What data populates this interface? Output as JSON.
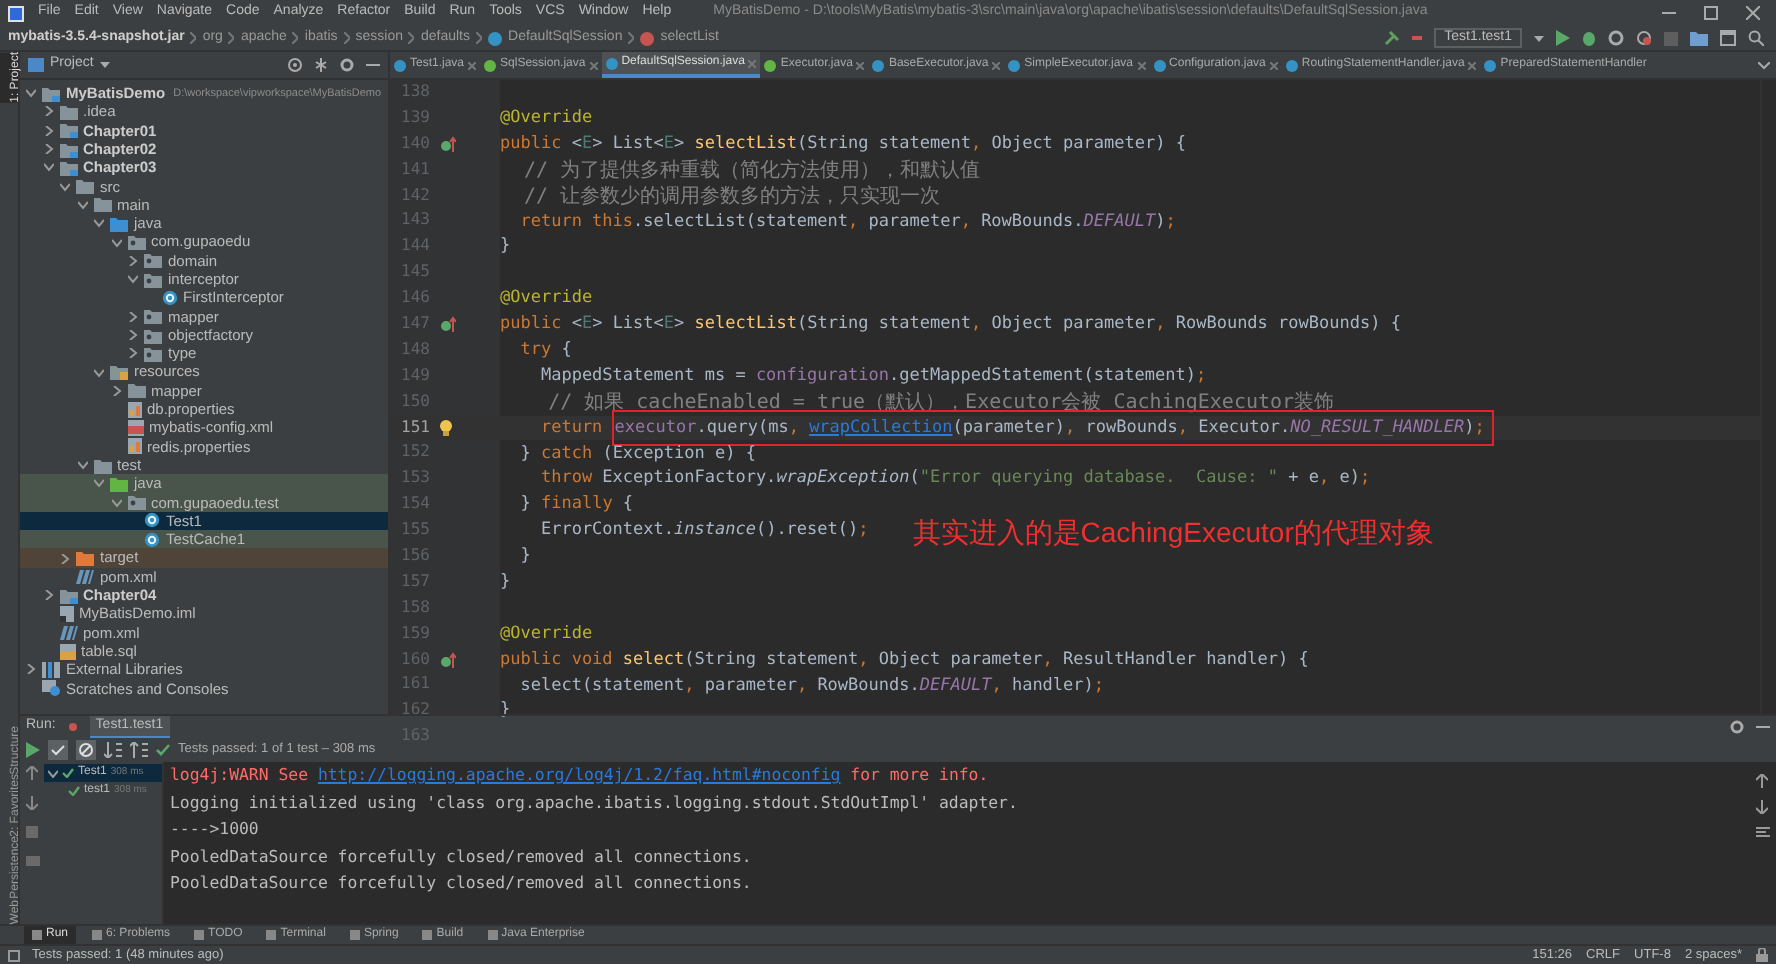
{
  "window": {
    "title": "MyBatisDemo - D:\\tools\\MyBatis\\mybatis-3\\src\\main\\java\\org\\apache\\ibatis\\session\\defaults\\DefaultSqlSession.java"
  },
  "menu": [
    "File",
    "Edit",
    "View",
    "Navigate",
    "Code",
    "Analyze",
    "Refactor",
    "Build",
    "Run",
    "Tools",
    "VCS",
    "Window",
    "Help"
  ],
  "breadcrumbs": [
    {
      "label": "mybatis-3.5.4-snapshot.jar",
      "kind": "jar"
    },
    {
      "label": "org",
      "kind": "package"
    },
    {
      "label": "apache",
      "kind": "package"
    },
    {
      "label": "ibatis",
      "kind": "package"
    },
    {
      "label": "session",
      "kind": "package"
    },
    {
      "label": "defaults",
      "kind": "package"
    },
    {
      "label": "DefaultSqlSession",
      "kind": "class"
    },
    {
      "label": "selectList",
      "kind": "method"
    }
  ],
  "run_config": "Test1.test1",
  "project_panel": {
    "title": "Project"
  },
  "left_strip": [
    {
      "label": "1: Project",
      "selected": true
    },
    {
      "label": "Structure",
      "selected": false
    },
    {
      "label": "2: Favorites",
      "selected": false
    },
    {
      "label": "Persistence",
      "selected": false
    },
    {
      "label": "Web",
      "selected": false
    }
  ],
  "tree": [
    {
      "label": "MyBatisDemo",
      "path": "D:\\workspace\\vipworkspace\\MyBatisDemo",
      "kind": "module",
      "expanded": true,
      "selected": false,
      "children": [
        {
          "label": ".idea",
          "kind": "folder",
          "expanded": false,
          "selected": false
        },
        {
          "label": "Chapter01",
          "kind": "module",
          "expanded": false,
          "selected": false
        },
        {
          "label": "Chapter02",
          "kind": "module",
          "expanded": false,
          "selected": false
        },
        {
          "label": "Chapter03",
          "kind": "module",
          "expanded": true,
          "selected": false,
          "children": [
            {
              "label": "src",
              "kind": "folder",
              "expanded": true,
              "selected": false,
              "children": [
                {
                  "label": "main",
                  "kind": "folder",
                  "expanded": true,
                  "selected": false,
                  "children": [
                    {
                      "label": "java",
                      "kind": "source-folder",
                      "expanded": true,
                      "selected": false,
                      "children": [
                        {
                          "label": "com.gupaoedu",
                          "kind": "package",
                          "expanded": true,
                          "selected": false,
                          "children": [
                            {
                              "label": "domain",
                              "kind": "package",
                              "expanded": false,
                              "selected": false
                            },
                            {
                              "label": "interceptor",
                              "kind": "package",
                              "expanded": true,
                              "selected": false,
                              "children": [
                                {
                                  "label": "FirstInterceptor",
                                  "kind": "class",
                                  "selected": false
                                }
                              ]
                            },
                            {
                              "label": "mapper",
                              "kind": "package",
                              "expanded": false,
                              "selected": false
                            },
                            {
                              "label": "objectfactory",
                              "kind": "package",
                              "expanded": false,
                              "selected": false
                            },
                            {
                              "label": "type",
                              "kind": "package",
                              "expanded": false,
                              "selected": false
                            }
                          ]
                        }
                      ]
                    },
                    {
                      "label": "resources",
                      "kind": "resources-folder",
                      "expanded": true,
                      "selected": false,
                      "children": [
                        {
                          "label": "mapper",
                          "kind": "folder",
                          "expanded": false,
                          "selected": false
                        },
                        {
                          "label": "db.properties",
                          "kind": "properties",
                          "selected": false
                        },
                        {
                          "label": "mybatis-config.xml",
                          "kind": "xml",
                          "selected": false
                        },
                        {
                          "label": "redis.properties",
                          "kind": "properties",
                          "selected": false
                        }
                      ]
                    }
                  ]
                },
                {
                  "label": "test",
                  "kind": "folder",
                  "expanded": true,
                  "selected": false,
                  "children": [
                    {
                      "label": "java",
                      "kind": "test-folder",
                      "expanded": true,
                      "selected": false,
                      "children": [
                        {
                          "label": "com.gupaoedu.test",
                          "kind": "test-package",
                          "expanded": true,
                          "selected": false,
                          "children": [
                            {
                              "label": "Test1",
                              "kind": "test-class",
                              "selected": true
                            },
                            {
                              "label": "TestCache1",
                              "kind": "test-class",
                              "selected": false
                            }
                          ]
                        }
                      ]
                    }
                  ]
                }
              ]
            },
            {
              "label": "target",
              "kind": "excluded-folder",
              "expanded": false,
              "selected": false
            },
            {
              "label": "pom.xml",
              "kind": "maven",
              "selected": false
            }
          ]
        },
        {
          "label": "Chapter04",
          "kind": "module",
          "expanded": false,
          "selected": false
        },
        {
          "label": "MyBatisDemo.iml",
          "kind": "iml",
          "selected": false
        },
        {
          "label": "pom.xml",
          "kind": "maven",
          "selected": false
        },
        {
          "label": "table.sql",
          "kind": "sql",
          "selected": false
        }
      ]
    },
    {
      "label": "External Libraries",
      "kind": "libraries",
      "expanded": false,
      "selected": false
    },
    {
      "label": "Scratches and Consoles",
      "kind": "scratches",
      "selected": false
    }
  ],
  "editor_tabs": [
    {
      "label": "Test1.java",
      "kind": "class",
      "selected": false
    },
    {
      "label": "SqlSession.java",
      "kind": "interface",
      "selected": false
    },
    {
      "label": "DefaultSqlSession.java",
      "kind": "class",
      "selected": true
    },
    {
      "label": "Executor.java",
      "kind": "interface",
      "selected": false
    },
    {
      "label": "BaseExecutor.java",
      "kind": "class",
      "selected": false
    },
    {
      "label": "SimpleExecutor.java",
      "kind": "class",
      "selected": false
    },
    {
      "label": "Configuration.java",
      "kind": "class",
      "selected": false
    },
    {
      "label": "RoutingStatementHandler.java",
      "kind": "class",
      "selected": false
    },
    {
      "label": "PreparedStatementHandler",
      "kind": "class",
      "selected": false
    }
  ],
  "code_lines": [
    {
      "number": "138",
      "kind": "code",
      "current": false
    },
    {
      "number": "139",
      "kind": "code",
      "current": false,
      "tokens": [
        {
          "text": "@Override",
          "kind": "annotation"
        }
      ]
    },
    {
      "number": "140",
      "kind": "override",
      "current": false,
      "tokens": [
        {
          "text": "public ",
          "kind": "keyword"
        },
        {
          "text": "<",
          "kind": "plain"
        },
        {
          "text": "E",
          "kind": "type-param"
        },
        {
          "text": "> List<",
          "kind": "plain"
        },
        {
          "text": "E",
          "kind": "type-param"
        },
        {
          "text": "> ",
          "kind": "plain"
        },
        {
          "text": "selectList",
          "kind": "method"
        },
        {
          "text": "(String statement",
          "kind": "plain"
        },
        {
          "text": ", ",
          "kind": "keyword"
        },
        {
          "text": "Object parameter) {",
          "kind": "plain"
        }
      ]
    },
    {
      "number": "141",
      "kind": "code",
      "current": false,
      "tokens": [
        {
          "text": "  // 为了提供多种重载（简化方法使用），和默认值",
          "kind": "comment"
        }
      ]
    },
    {
      "number": "142",
      "kind": "code",
      "current": false,
      "tokens": [
        {
          "text": "  // 让参数少的调用参数多的方法，只实现一次",
          "kind": "comment"
        }
      ]
    },
    {
      "number": "143",
      "kind": "code",
      "current": false,
      "tokens": [
        {
          "text": "  return this",
          "kind": "keyword"
        },
        {
          "text": ".selectList(statement",
          "kind": "plain"
        },
        {
          "text": ", ",
          "kind": "keyword"
        },
        {
          "text": "parameter",
          "kind": "plain"
        },
        {
          "text": ", ",
          "kind": "keyword"
        },
        {
          "text": "RowBounds.",
          "kind": "plain"
        },
        {
          "text": "DEFAULT",
          "kind": "constant"
        },
        {
          "text": ")",
          "kind": "plain"
        },
        {
          "text": ";",
          "kind": "keyword"
        }
      ]
    },
    {
      "number": "144",
      "kind": "code",
      "current": false,
      "tokens": [
        {
          "text": "}",
          "kind": "plain"
        }
      ]
    },
    {
      "number": "145",
      "kind": "code",
      "current": false
    },
    {
      "number": "146",
      "kind": "code",
      "current": false,
      "tokens": [
        {
          "text": "@Override",
          "kind": "annotation"
        }
      ]
    },
    {
      "number": "147",
      "kind": "override",
      "current": false,
      "tokens": [
        {
          "text": "public ",
          "kind": "keyword"
        },
        {
          "text": "<",
          "kind": "plain"
        },
        {
          "text": "E",
          "kind": "type-param"
        },
        {
          "text": "> List<",
          "kind": "plain"
        },
        {
          "text": "E",
          "kind": "type-param"
        },
        {
          "text": "> ",
          "kind": "plain"
        },
        {
          "text": "selectList",
          "kind": "method"
        },
        {
          "text": "(String statement",
          "kind": "plain"
        },
        {
          "text": ", ",
          "kind": "keyword"
        },
        {
          "text": "Object parameter",
          "kind": "plain"
        },
        {
          "text": ", ",
          "kind": "keyword"
        },
        {
          "text": "RowBounds rowBounds) {",
          "kind": "plain"
        }
      ]
    },
    {
      "number": "148",
      "kind": "code",
      "current": false,
      "tokens": [
        {
          "text": "  try",
          "kind": "keyword"
        },
        {
          "text": " {",
          "kind": "plain"
        }
      ]
    },
    {
      "number": "149",
      "kind": "code",
      "current": false,
      "tokens": [
        {
          "text": "    MappedStatement ms = ",
          "kind": "plain"
        },
        {
          "text": "configuration",
          "kind": "field"
        },
        {
          "text": ".getMappedStatement(statement)",
          "kind": "plain"
        },
        {
          "text": ";",
          "kind": "keyword"
        }
      ]
    },
    {
      "number": "150",
      "kind": "code",
      "current": false,
      "tokens": [
        {
          "text": "    // 如果 cacheEnabled = true（默认），Executor会被 CachingExecutor装饰",
          "kind": "comment"
        }
      ]
    },
    {
      "number": "151",
      "kind": "intention",
      "current": true,
      "tokens": [
        {
          "text": "    return ",
          "kind": "keyword"
        }
      ],
      "boxed_tokens": [
        {
          "text": "executor",
          "kind": "field"
        },
        {
          "text": ".query(ms",
          "kind": "plain"
        },
        {
          "text": ", ",
          "kind": "keyword"
        },
        {
          "text": "wrapCollection",
          "kind": "link"
        },
        {
          "text": "(parameter)",
          "kind": "plain"
        },
        {
          "text": ", ",
          "kind": "keyword"
        },
        {
          "text": "rowBounds",
          "kind": "plain"
        },
        {
          "text": ", ",
          "kind": "keyword"
        },
        {
          "text": "Executor.",
          "kind": "plain"
        },
        {
          "text": "NO_RESULT_HANDLER",
          "kind": "constant"
        },
        {
          "text": ")",
          "kind": "plain"
        },
        {
          "text": ";",
          "kind": "keyword"
        }
      ]
    },
    {
      "number": "152",
      "kind": "code",
      "current": false,
      "tokens": [
        {
          "text": "  } ",
          "kind": "plain"
        },
        {
          "text": "catch",
          "kind": "keyword"
        },
        {
          "text": " (Exception e) {",
          "kind": "plain"
        }
      ]
    },
    {
      "number": "153",
      "kind": "code",
      "current": false,
      "tokens": [
        {
          "text": "    throw",
          "kind": "keyword"
        },
        {
          "text": " ExceptionFactory.",
          "kind": "plain"
        },
        {
          "text": "wrapException",
          "kind": "italic"
        },
        {
          "text": "(",
          "kind": "plain"
        },
        {
          "text": "\"Error querying database.  Cause: \"",
          "kind": "string"
        },
        {
          "text": " + e",
          "kind": "plain"
        },
        {
          "text": ", ",
          "kind": "keyword"
        },
        {
          "text": "e)",
          "kind": "plain"
        },
        {
          "text": ";",
          "kind": "keyword"
        }
      ]
    },
    {
      "number": "154",
      "kind": "code",
      "current": false,
      "tokens": [
        {
          "text": "  } ",
          "kind": "plain"
        },
        {
          "text": "finally",
          "kind": "keyword"
        },
        {
          "text": " {",
          "kind": "plain"
        }
      ]
    },
    {
      "number": "155",
      "kind": "code",
      "current": false,
      "note": "其实进入的是CachingExecutor的代理对象",
      "tokens": [
        {
          "text": "    ErrorContext.",
          "kind": "plain"
        },
        {
          "text": "instance",
          "kind": "italic"
        },
        {
          "text": "().reset()",
          "kind": "plain"
        },
        {
          "text": ";",
          "kind": "keyword"
        }
      ]
    },
    {
      "number": "156",
      "kind": "code",
      "current": false,
      "tokens": [
        {
          "text": "  }",
          "kind": "plain"
        }
      ]
    },
    {
      "number": "157",
      "kind": "code",
      "current": false,
      "tokens": [
        {
          "text": "}",
          "kind": "plain"
        }
      ]
    },
    {
      "number": "158",
      "kind": "code",
      "current": false
    },
    {
      "number": "159",
      "kind": "code",
      "current": false,
      "tokens": [
        {
          "text": "@Override",
          "kind": "annotation"
        }
      ]
    },
    {
      "number": "160",
      "kind": "override",
      "current": false,
      "tokens": [
        {
          "text": "public void ",
          "kind": "keyword"
        },
        {
          "text": "select",
          "kind": "method"
        },
        {
          "text": "(String statement",
          "kind": "plain"
        },
        {
          "text": ", ",
          "kind": "keyword"
        },
        {
          "text": "Object parameter",
          "kind": "plain"
        },
        {
          "text": ", ",
          "kind": "keyword"
        },
        {
          "text": "ResultHandler handler) {",
          "kind": "plain"
        }
      ]
    },
    {
      "number": "161",
      "kind": "code",
      "current": false,
      "tokens": [
        {
          "text": "  select(statement",
          "kind": "plain"
        },
        {
          "text": ", ",
          "kind": "keyword"
        },
        {
          "text": "parameter",
          "kind": "plain"
        },
        {
          "text": ", ",
          "kind": "keyword"
        },
        {
          "text": "RowBounds.",
          "kind": "plain"
        },
        {
          "text": "DEFAULT",
          "kind": "constant"
        },
        {
          "text": ", ",
          "kind": "keyword"
        },
        {
          "text": "handler)",
          "kind": "plain"
        },
        {
          "text": ";",
          "kind": "keyword"
        }
      ]
    },
    {
      "number": "162",
      "kind": "code",
      "current": false,
      "tokens": [
        {
          "text": "}",
          "kind": "plain"
        }
      ]
    },
    {
      "number": "163",
      "kind": "code",
      "current": false
    }
  ],
  "run_panel": {
    "label": "Run:",
    "tab": "Test1.test1",
    "summary": "Tests passed: 1 of 1 test – 308 ms",
    "tests": [
      {
        "label": "Test1",
        "time": "308 ms",
        "passed": true,
        "expanded": true,
        "selected": true,
        "children": [
          {
            "label": "test1",
            "time": "308 ms",
            "passed": true,
            "selected": false
          }
        ]
      }
    ],
    "console": [
      {
        "segments": [
          {
            "text": "log4j:WARN See ",
            "kind": "warn"
          },
          {
            "text": "http://logging.apache.org/log4j/1.2/faq.html#noconfig",
            "kind": "link"
          },
          {
            "text": " for more info.",
            "kind": "warn"
          }
        ]
      },
      {
        "segments": [
          {
            "text": "Logging initialized using 'class org.apache.ibatis.logging.stdout.StdOutImpl' adapter.",
            "kind": "output"
          }
        ]
      },
      {
        "segments": [
          {
            "text": "---->1000",
            "kind": "output"
          }
        ]
      },
      {
        "segments": [
          {
            "text": "PooledDataSource forcefully closed/removed all connections.",
            "kind": "output"
          }
        ]
      },
      {
        "segments": [
          {
            "text": "PooledDataSource forcefully closed/removed all connections.",
            "kind": "output"
          }
        ]
      }
    ]
  },
  "tool_tabs": [
    {
      "label": "Run",
      "selected": true
    },
    {
      "label": "6: Problems",
      "selected": false
    },
    {
      "label": "TODO",
      "selected": false
    },
    {
      "label": "Terminal",
      "selected": false
    },
    {
      "label": "Spring",
      "selected": false
    },
    {
      "label": "Build",
      "selected": false
    },
    {
      "label": "Java Enterprise",
      "selected": false
    }
  ],
  "status_bar": {
    "message": "Tests passed: 1 (48 minutes ago)",
    "position": "151:26",
    "line_separator": "CRLF",
    "encoding": "UTF-8",
    "indent": "2 spaces*"
  }
}
